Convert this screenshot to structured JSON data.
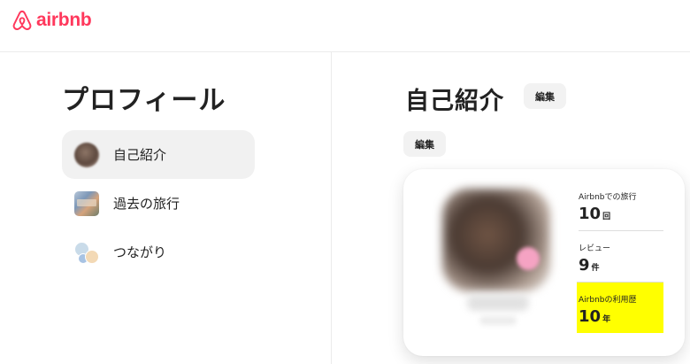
{
  "brand": {
    "logo_text": "airbnb",
    "color": "#FF385C"
  },
  "left": {
    "title": "プロフィール",
    "nav_items": [
      {
        "label": "自己紹介",
        "thumb": "avatar-thumbnail",
        "active": true
      },
      {
        "label": "過去の旅行",
        "thumb": "trips-thumbnail",
        "active": false
      },
      {
        "label": "つながり",
        "thumb": "connections-thumbnail",
        "active": false
      }
    ]
  },
  "right": {
    "title": "自己紹介",
    "edit_label": "編集",
    "edit_label_2": "編集",
    "stats": [
      {
        "label": "Airbnbでの旅行",
        "value": "10",
        "unit": "回"
      },
      {
        "label": "レビュー",
        "value": "9",
        "unit": "件"
      },
      {
        "label": "Airbnbの利用歴",
        "value": "10",
        "unit": "年",
        "highlight": "#FFFF00"
      }
    ]
  }
}
